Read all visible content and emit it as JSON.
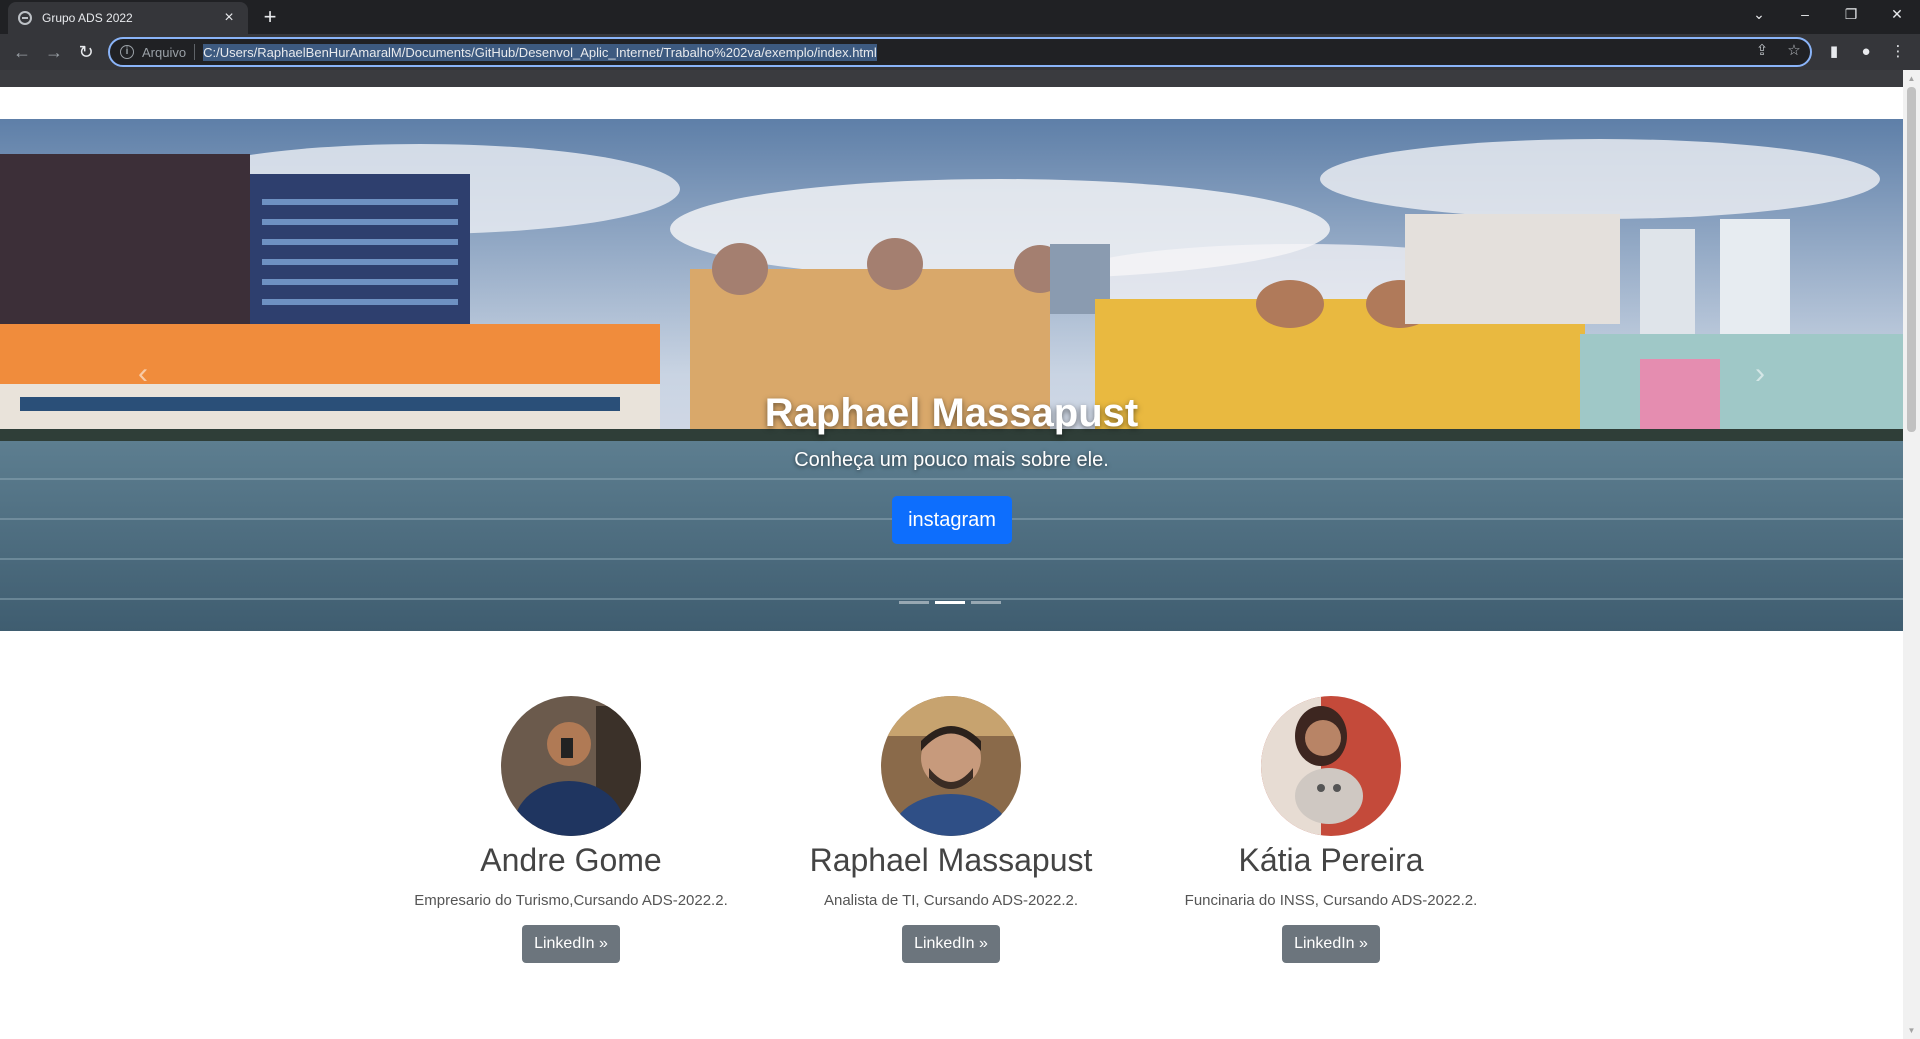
{
  "browser": {
    "tab_title": "Grupo ADS 2022",
    "tab_close": "×",
    "new_tab": "+",
    "scheme_label": "Arquivo",
    "url": "C:/Users/RaphaelBenHurAmaralM/Documents/GitHub/Desenvol_Aplic_Internet/Trabalho%202va/exemplo/index.html",
    "window_controls": {
      "dropdown": "⌄",
      "minimize": "–",
      "restore": "❐",
      "close": "✕"
    }
  },
  "carousel": {
    "title": "Raphael Massapust",
    "subtitle": "Conheça um pouco mais sobre ele.",
    "button_label": "instagram",
    "prev_icon": "‹",
    "next_icon": "›",
    "active_indicator": 2,
    "indicator_count": 3
  },
  "members": [
    {
      "name": "Andre Gome",
      "description": "Empresario do Turismo,Cursando ADS-2022.2.",
      "button_label": "LinkedIn »"
    },
    {
      "name": "Raphael Massapust",
      "description": "Analista de TI, Cursando ADS-2022.2.",
      "button_label": "LinkedIn »"
    },
    {
      "name": "Kátia Pereira",
      "description": "Funcinaria do INSS, Cursando ADS-2022.2.",
      "button_label": "LinkedIn »"
    }
  ],
  "colors": {
    "primary_button": "#0d6efd",
    "secondary_button": "#6c757d",
    "omnibox_focus": "#8ab4f8"
  }
}
